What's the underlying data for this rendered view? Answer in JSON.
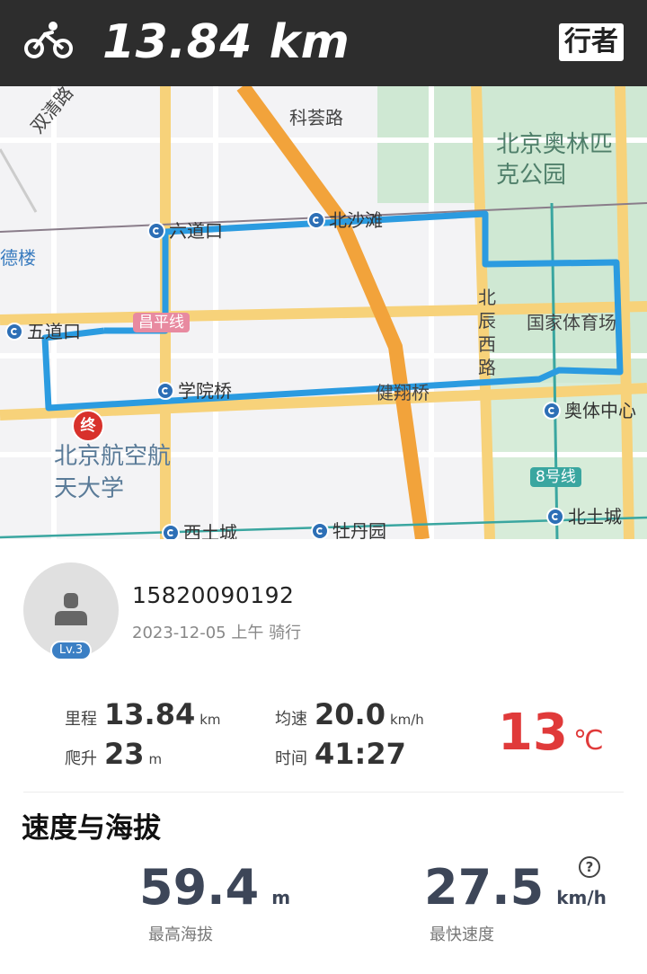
{
  "header": {
    "distance": "13.84 km",
    "brand": "行者",
    "background_color": "#2d2d2d",
    "icon": "bicycle-icon"
  },
  "map": {
    "road_labels": [
      "科荟路",
      "双清路",
      "北辰西路"
    ],
    "area_labels": [
      "北京奥林匹克公园",
      "北京航空航天大学",
      "国家体育场"
    ],
    "stations": [
      "六道口",
      "北沙滩",
      "五道口",
      "学院桥",
      "健翔桥",
      "奥体中心",
      "北土城",
      "西土城",
      "牡丹园",
      "德楼"
    ],
    "line_labels": [
      "8号线",
      "昌平线"
    ],
    "end_marker": "终",
    "route_color": "#2b9be0"
  },
  "profile": {
    "username": "15820090192",
    "date": "2023-12-05",
    "period": "上午",
    "activity": "骑行",
    "level": "Lv.3"
  },
  "stats": {
    "distance_label": "里程",
    "distance_value": "13.84",
    "distance_unit": "km",
    "avg_speed_label": "均速",
    "avg_speed_value": "20.0",
    "avg_speed_unit": "km/h",
    "climb_label": "爬升",
    "climb_value": "23",
    "climb_unit": "m",
    "time_label": "时间",
    "time_value": "41:27",
    "temperature_value": "13",
    "temperature_unit": "℃",
    "temperature_color": "#e03a3a"
  },
  "speed_altitude": {
    "title": "速度与海拔",
    "max_altitude_value": "59.4",
    "max_altitude_unit": "m",
    "max_altitude_label": "最高海拔",
    "max_speed_value": "27.5",
    "max_speed_unit": "km/h",
    "max_speed_label": "最快速度",
    "help_icon": "question-icon"
  }
}
